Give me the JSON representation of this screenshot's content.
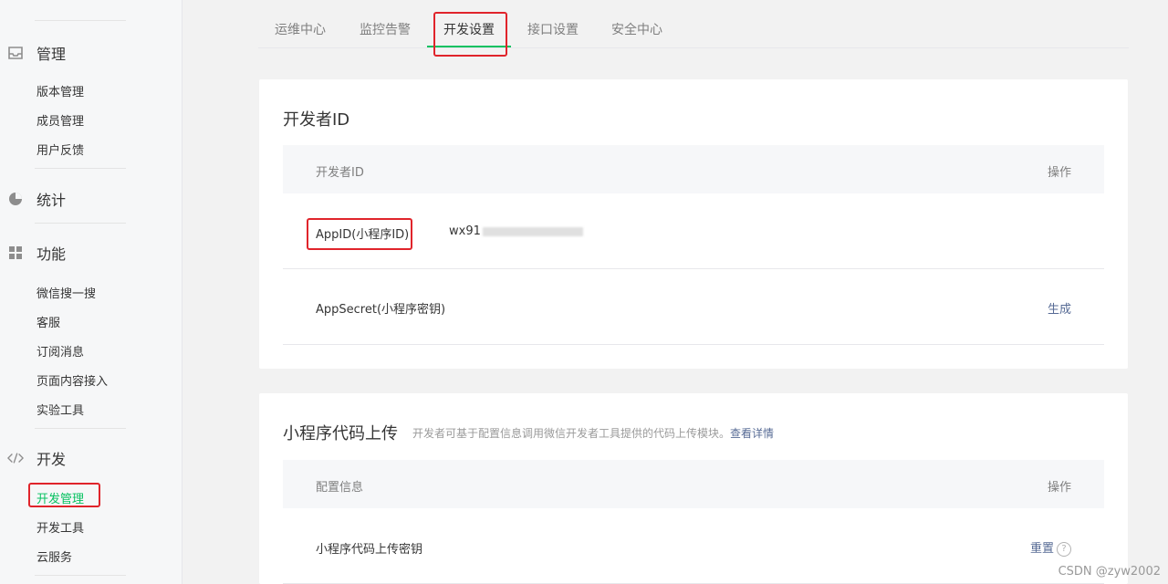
{
  "sidebar": {
    "sections": [
      {
        "title": "管理",
        "icon": "inbox-icon",
        "items": [
          "版本管理",
          "成员管理",
          "用户反馈"
        ]
      },
      {
        "title": "统计",
        "icon": "pie-chart-icon",
        "items": []
      },
      {
        "title": "功能",
        "icon": "grid-icon",
        "items": [
          "微信搜一搜",
          "客服",
          "订阅消息",
          "页面内容接入",
          "实验工具"
        ]
      },
      {
        "title": "开发",
        "icon": "code-icon",
        "items": [
          "开发管理",
          "开发工具",
          "云服务"
        ]
      }
    ],
    "active_item": "开发管理"
  },
  "tabs": [
    "运维中心",
    "监控告警",
    "开发设置",
    "接口设置",
    "安全中心"
  ],
  "active_tab": "开发设置",
  "developer_id": {
    "title": "开发者ID",
    "header_left": "开发者ID",
    "header_right": "操作",
    "appid_label": "AppID(小程序ID)",
    "appid_value": "wx91",
    "appsecret_label": "AppSecret(小程序密钥)",
    "appsecret_action": "生成"
  },
  "upload": {
    "title": "小程序代码上传",
    "desc": "开发者可基于配置信息调用微信开发者工具提供的代码上传模块。",
    "desc_link": "查看详情",
    "header_left": "配置信息",
    "header_right": "操作",
    "row_label": "小程序代码上传密钥",
    "row_action": "重置",
    "help_glyph": "?"
  },
  "watermark": "CSDN @zyw2002",
  "colors": {
    "accent": "#07c160",
    "highlight_box": "#e0242b",
    "link": "#576b95"
  }
}
